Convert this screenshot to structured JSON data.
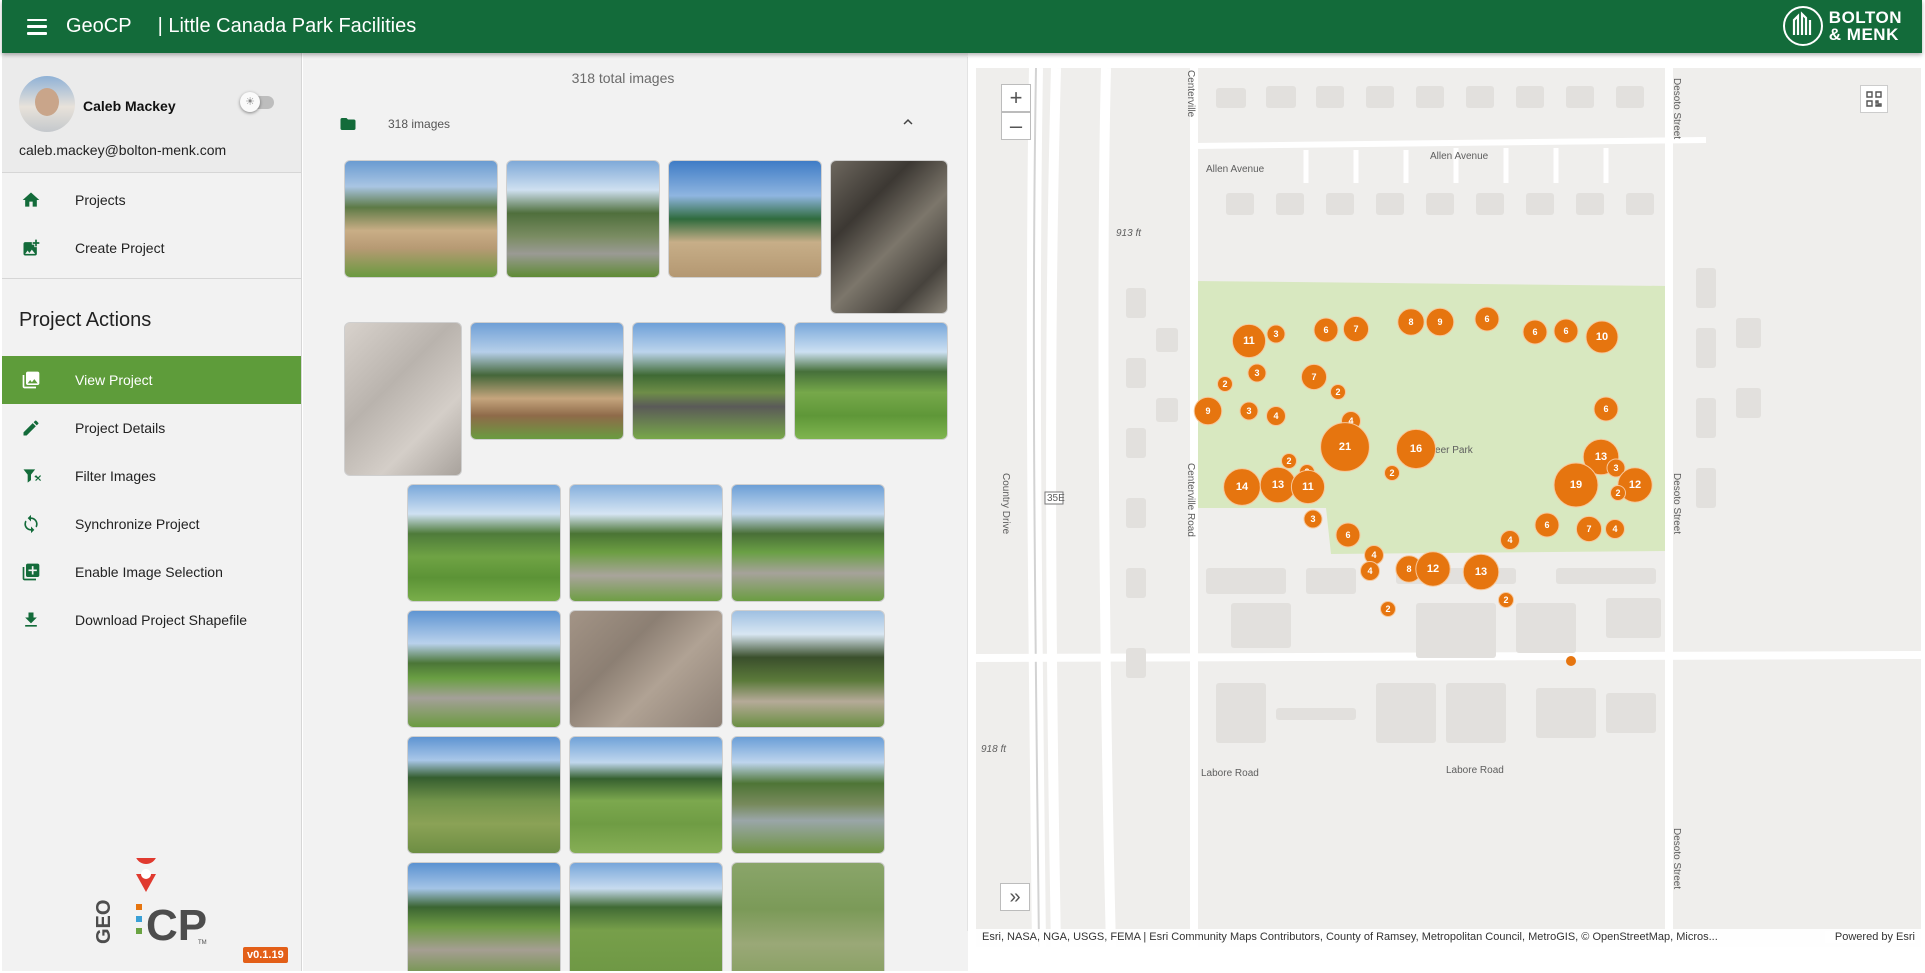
{
  "header": {
    "app_title": "GeoCP",
    "project_title": "| Little Canada Park Facilities",
    "brand_line1": "BOLTON",
    "brand_line2": "& MENK"
  },
  "user": {
    "name": "Caleb Mackey",
    "email": "caleb.mackey@bolton-menk.com"
  },
  "nav": [
    {
      "label": "Projects",
      "icon": "home-icon"
    },
    {
      "label": "Create Project",
      "icon": "add-photo-icon"
    }
  ],
  "actions_heading": "Project Actions",
  "actions": [
    {
      "label": "View Project",
      "icon": "photo-library-icon",
      "active": true
    },
    {
      "label": "Project Details",
      "icon": "pencil-icon"
    },
    {
      "label": "Filter Images",
      "icon": "filter-off-icon"
    },
    {
      "label": "Synchronize Project",
      "icon": "sync-icon"
    },
    {
      "label": "Enable Image Selection",
      "icon": "add-box-icon"
    },
    {
      "label": "Download Project Shapefile",
      "icon": "download-icon"
    }
  ],
  "version": "v0.1.19",
  "logo": {
    "geo": "GEO",
    "cp": "CP",
    "tm": "TM"
  },
  "gallery": {
    "total": "318 total images",
    "folder_label": "318 images"
  },
  "map": {
    "streets": {
      "allen1": "Allen Avenue",
      "allen2": "Allen Avenue",
      "labore1": "Labore Road",
      "labore2": "Labore Road",
      "desoto1": "Desoto Street",
      "desoto2": "Desoto Street",
      "desoto3": "Desoto Street",
      "centerville1": "Centerville Road",
      "centerville2": "Centerville",
      "country": "Country Drive",
      "highway": "35E"
    },
    "park": "Pioneer Park",
    "elev1": "913 ft",
    "elev2": "918 ft",
    "attribution": "Esri, NASA, NGA, USGS, FEMA | Esri Community Maps Contributors, County of Ramsey, Metropolitan Council, MetroGIS, © OpenStreetMap, Micros...",
    "powered": "Powered by Esri",
    "accent": "#e6750f",
    "clusters": [
      11,
      3,
      6,
      7,
      8,
      9,
      6,
      6,
      6,
      10,
      2,
      3,
      7,
      2,
      4,
      3,
      9,
      4,
      21,
      6,
      16,
      2,
      13,
      3,
      2,
      2,
      19,
      12,
      14,
      13,
      11,
      2,
      3,
      6,
      6,
      7,
      4,
      4,
      4,
      8,
      12,
      13,
      4,
      2,
      2,
      2
    ]
  },
  "colors": {
    "header": "#136b3a",
    "active_nav": "#5e9c3a",
    "version_badge": "#e35f18"
  }
}
